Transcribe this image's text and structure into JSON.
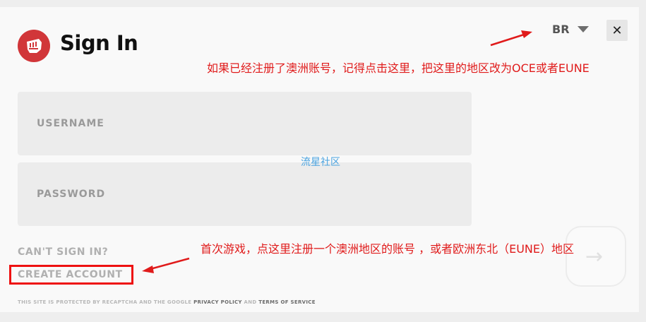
{
  "header": {
    "title": "Sign In",
    "logo_icon": "riot-fist-icon",
    "region": "BR",
    "close_label": "✕"
  },
  "form": {
    "username_label": "USERNAME",
    "password_label": "PASSWORD"
  },
  "links": {
    "cant_sign_in": "CAN'T SIGN IN?",
    "create_account": "CREATE ACCOUNT"
  },
  "legal": {
    "prefix": "THIS SITE IS PROTECTED BY RECAPTCHA AND THE GOOGLE ",
    "privacy": "PRIVACY POLICY",
    "and": " AND ",
    "terms": "TERMS OF SERVICE"
  },
  "next_button": {
    "icon": "arrow-right-icon",
    "glyph": "→"
  },
  "annotations": {
    "region_note": "如果已经注册了澳洲账号，记得点击这里，把这里的地区改为OCE或者EUNE",
    "create_note": "首次游戏，点这里注册一个澳洲地区的账号 ，或者欧洲东北（EUNE）地区",
    "color": "#e01b1b"
  },
  "watermark": "流星社区",
  "colors": {
    "brand": "#d13639",
    "annotation": "#e01b1b",
    "highlight": "#ee1111"
  }
}
